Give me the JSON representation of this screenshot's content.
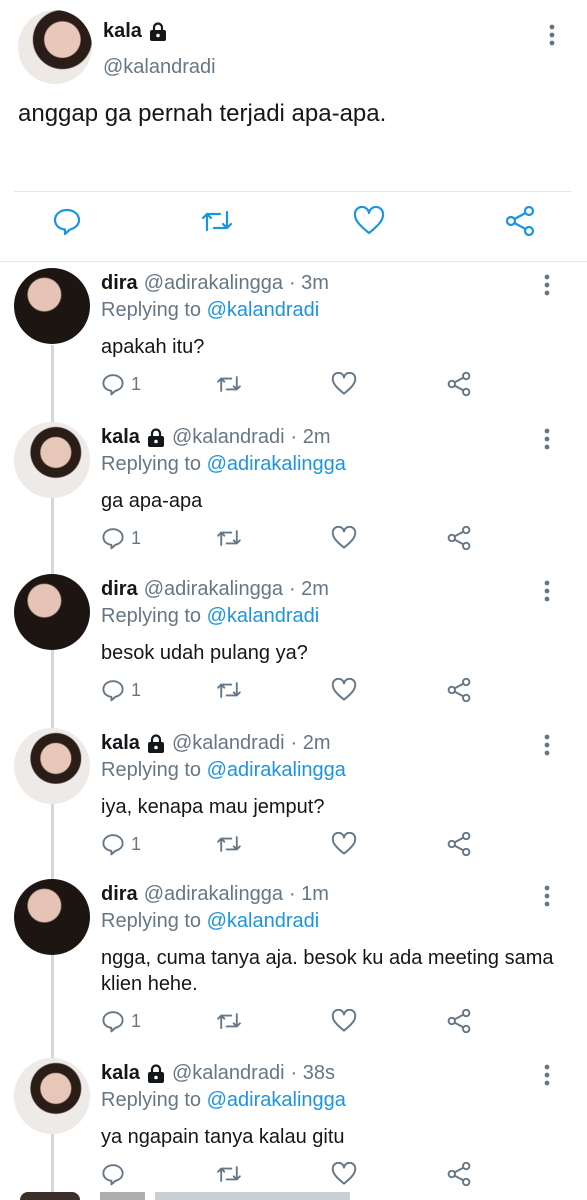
{
  "main_tweet": {
    "name": "kala",
    "handle": "@kalandradi",
    "text": "anggap ga pernah terjadi apa-apa."
  },
  "replies": [
    {
      "name": "dira",
      "handle": "@adirakalingga",
      "time": "· 3m",
      "locked": false,
      "replying_prefix": "Replying to",
      "replying_to": "@kalandradi",
      "text": "apakah itu?",
      "reply_count": "1"
    },
    {
      "name": "kala",
      "handle": "@kalandradi",
      "time": "· 2m",
      "locked": true,
      "replying_prefix": "Replying to",
      "replying_to": "@adirakalingga",
      "text": "ga apa-apa",
      "reply_count": "1"
    },
    {
      "name": "dira",
      "handle": "@adirakalingga",
      "time": "· 2m",
      "locked": false,
      "replying_prefix": "Replying to",
      "replying_to": "@kalandradi",
      "text": "besok udah pulang ya?",
      "reply_count": "1"
    },
    {
      "name": "kala",
      "handle": "@kalandradi",
      "time": "· 2m",
      "locked": true,
      "replying_prefix": "Replying to",
      "replying_to": "@adirakalingga",
      "text": "iya, kenapa mau jemput?",
      "reply_count": "1"
    },
    {
      "name": "dira",
      "handle": "@adirakalingga",
      "time": "· 1m",
      "locked": false,
      "replying_prefix": "Replying to",
      "replying_to": "@kalandradi",
      "text": "ngga, cuma tanya aja. besok ku ada meeting sama klien hehe.",
      "reply_count": "1"
    },
    {
      "name": "kala",
      "handle": "@kalandradi",
      "time": "· 38s",
      "locked": true,
      "replying_prefix": "Replying to",
      "replying_to": "@adirakalingga",
      "text": "ya ngapain tanya kalau gitu",
      "reply_count": ""
    }
  ],
  "icons": {
    "reply": "reply-icon",
    "retweet": "retweet-icon",
    "like": "heart-icon",
    "share": "share-icon",
    "more": "more-vertical-icon",
    "lock": "lock-icon"
  },
  "colors": {
    "text": "#14171a",
    "secondary": "#657786",
    "link": "#1b95e0",
    "divider": "#e1e8ed",
    "thread_line": "#cfd9de"
  }
}
